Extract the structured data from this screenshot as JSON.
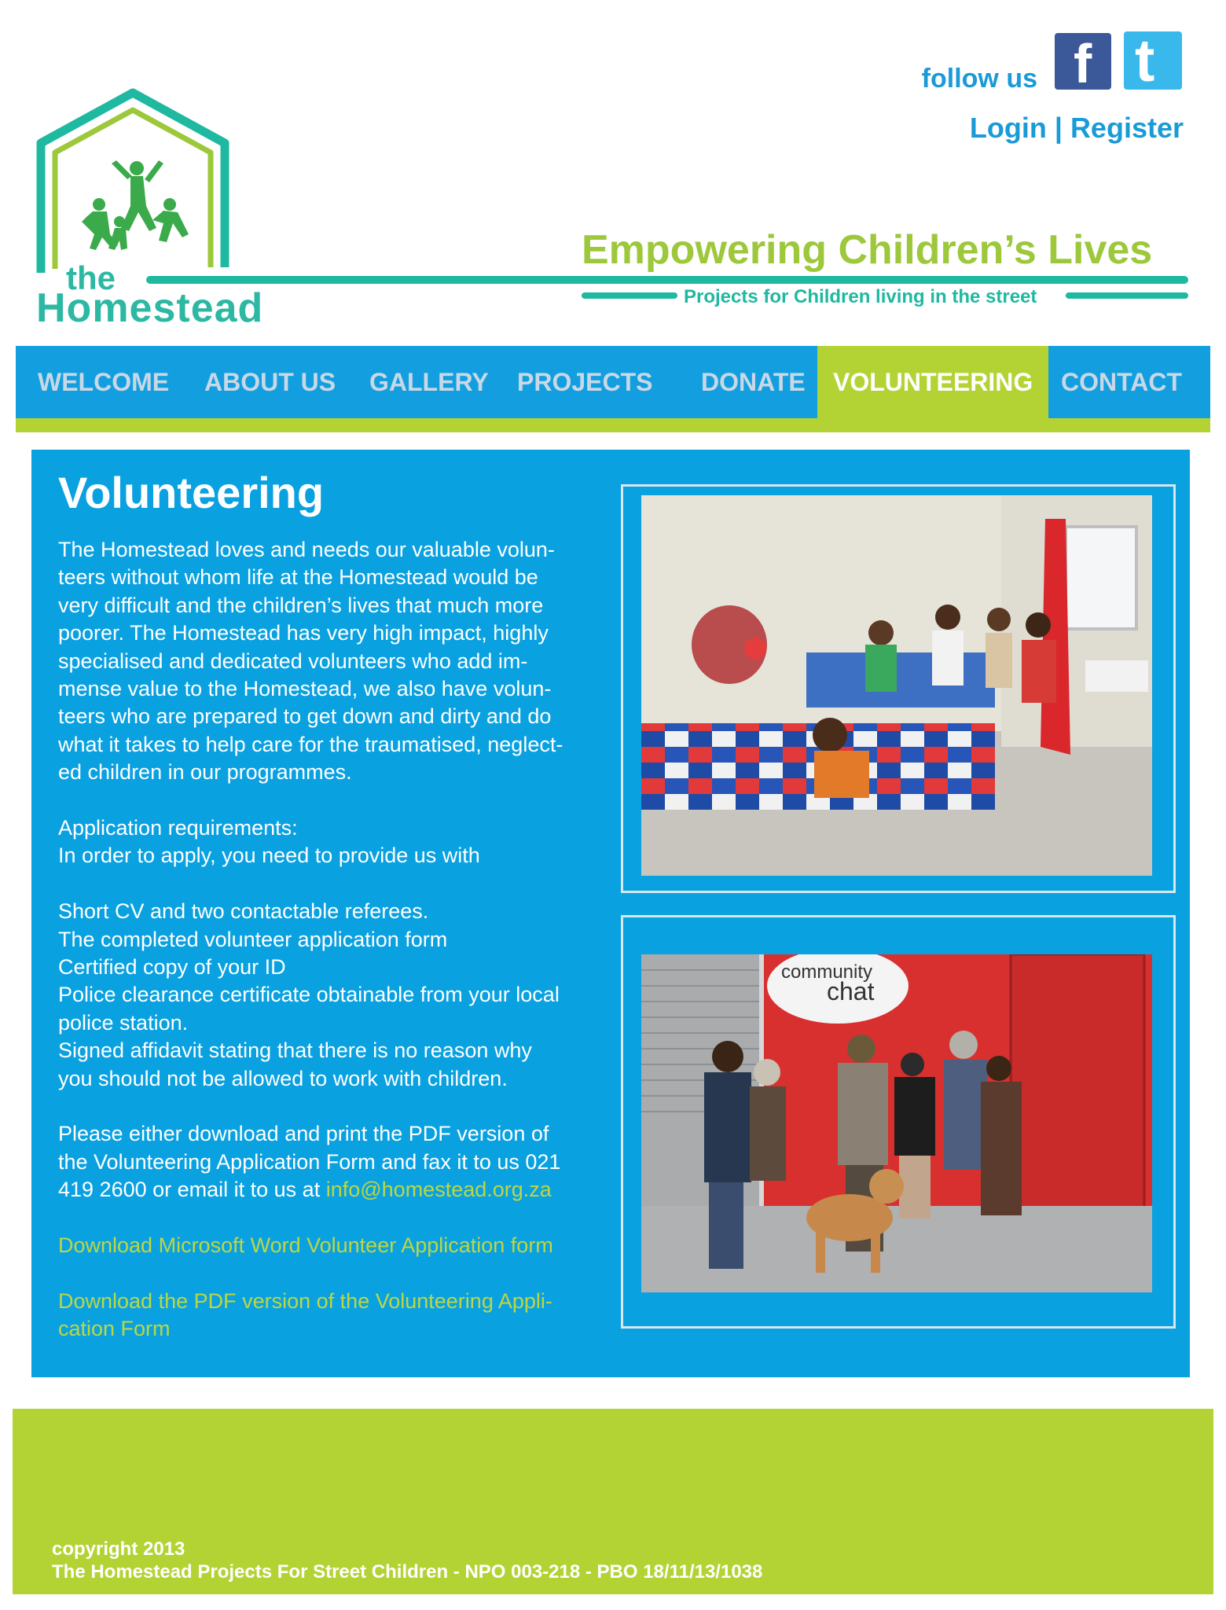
{
  "header": {
    "follow_label": "follow us",
    "facebook_glyph": "f",
    "twitter_glyph": "t",
    "login_label": "Login",
    "separator": "|",
    "register_label": "Register",
    "logo_small": "the",
    "logo_name": "Homestead",
    "tagline": "Empowering Children’s Lives",
    "subtagline": "Projects for Children living in the street"
  },
  "nav": {
    "items": [
      {
        "label": "WELCOME"
      },
      {
        "label": "ABOUT US"
      },
      {
        "label": "GALLERY"
      },
      {
        "label": "PROJECTS"
      },
      {
        "label": "DONATE"
      },
      {
        "label": "VOLUNTEERING"
      },
      {
        "label": "CONTACT"
      }
    ],
    "active": "VOLUNTEERING"
  },
  "content": {
    "title": "Volunteering",
    "intro_lines": [
      "The Homestead loves and needs our valuable volun-",
      "teers without whom life at the Homestead would be",
      "very difficult and the children’s lives that much more",
      "poorer. The Homestead has very high impact, highly",
      "specialised and dedicated volunteers who add im-",
      "mense value to the Homestead, we also have volun-",
      "teers who are prepared to get down and dirty and do",
      "what it takes to help care for the traumatised, neglect-",
      "ed children in our programmes."
    ],
    "requirements_heading": "Application requirements:",
    "requirements_intro": "In order to apply, you need to provide us with",
    "requirements": [
      "Short CV and two contactable referees.",
      "The completed volunteer application form",
      "Certified copy of your ID",
      "Police clearance certificate obtainable from your local",
      "police station.",
      "Signed affidavit  stating that there is no reason why",
      "you should not be allowed to work with children."
    ],
    "instructions_lines": [
      "Please either download and print the PDF version of",
      "the Volunteering Application Form and fax it to us 021"
    ],
    "instructions_last": "419 2600 or  email it to us at ",
    "email": "info@homestead.org.za",
    "download_word": "Download Microsoft Word Volunteer Application form",
    "download_pdf_line1": "Download the PDF version of the Volunteering Appli-",
    "download_pdf_line2": "cation Form"
  },
  "photos": {
    "photo2_sign_line1": "community",
    "photo2_sign_line2": "chat"
  },
  "footer": {
    "copyright": "copyright 2013",
    "org_line": "The Homestead Projects For Street Children - NPO 003-218 - PBO 18/11/13/1038"
  },
  "colors": {
    "blue": "#139fdf",
    "green": "#b3d335",
    "teal": "#1fb8a0",
    "link_green": "#bdd741"
  }
}
